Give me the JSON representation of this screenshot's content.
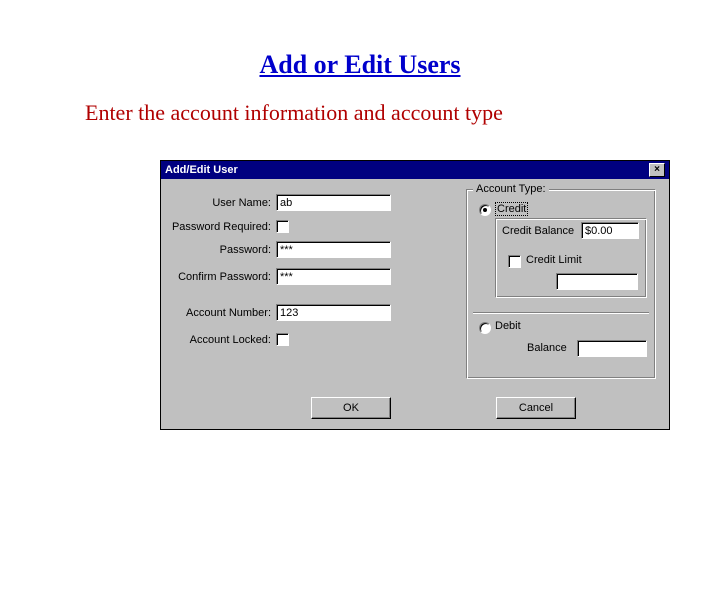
{
  "page": {
    "title": "Add or Edit Users",
    "subtitle": "Enter the account information and account type"
  },
  "dialog": {
    "title": "Add/Edit User",
    "close_glyph": "×",
    "labels": {
      "user_name": "User Name:",
      "password_required": "Password Required:",
      "password": "Password:",
      "confirm_password": "Confirm Password:",
      "account_number": "Account Number:",
      "account_locked": "Account Locked:"
    },
    "values": {
      "user_name": "ab",
      "password": "***",
      "confirm_password": "***",
      "account_number": "123"
    },
    "account_type": {
      "legend": "Account Type:",
      "credit": {
        "label": "Credit",
        "balance_label": "Credit Balance",
        "balance_value": "$0.00",
        "limit_label": "Credit Limit"
      },
      "debit": {
        "label": "Debit",
        "balance_label": "Balance"
      }
    },
    "buttons": {
      "ok": "OK",
      "cancel": "Cancel"
    }
  }
}
